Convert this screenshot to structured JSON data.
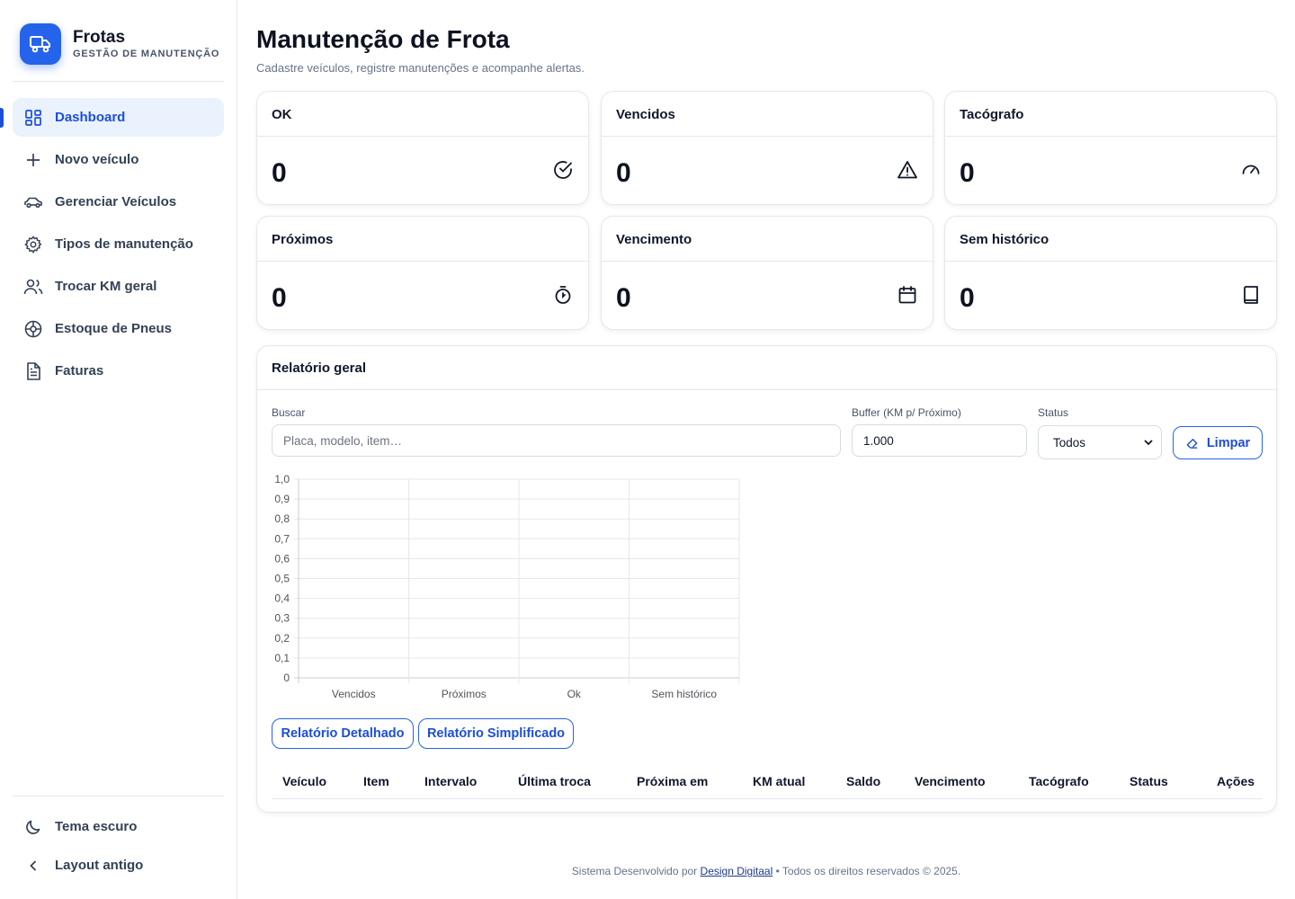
{
  "brand": {
    "title": "Frotas",
    "subtitle": "GESTÃO DE MANUTENÇÃO"
  },
  "sidebar": {
    "items": [
      {
        "label": "Dashboard",
        "icon": "dashboard-grid-icon",
        "active": true
      },
      {
        "label": "Novo veículo",
        "icon": "plus-icon"
      },
      {
        "label": "Gerenciar Veículos",
        "icon": "car-icon"
      },
      {
        "label": "Tipos de manutenção",
        "icon": "gear-icon"
      },
      {
        "label": "Trocar KM geral",
        "icon": "users-icon"
      },
      {
        "label": "Estoque de Pneus",
        "icon": "tire-icon"
      },
      {
        "label": "Faturas",
        "icon": "document-icon"
      }
    ],
    "bottom": [
      {
        "label": "Tema escuro",
        "icon": "moon-icon"
      },
      {
        "label": "Layout antigo",
        "icon": "chevron-left-icon"
      }
    ]
  },
  "header": {
    "title": "Manutenção de Frota",
    "subtitle": "Cadastre veículos, registre manutenções e acompanhe alertas."
  },
  "stats": [
    {
      "label": "OK",
      "value": "0",
      "icon": "check-circle-icon"
    },
    {
      "label": "Vencidos",
      "value": "0",
      "icon": "warning-triangle-icon"
    },
    {
      "label": "Tacógrafo",
      "value": "0",
      "icon": "gauge-icon"
    },
    {
      "label": "Próximos",
      "value": "0",
      "icon": "stopwatch-icon"
    },
    {
      "label": "Vencimento",
      "value": "0",
      "icon": "calendar-icon"
    },
    {
      "label": "Sem histórico",
      "value": "0",
      "icon": "book-icon"
    }
  ],
  "report": {
    "title": "Relatório geral",
    "search": {
      "label": "Buscar",
      "placeholder": "Placa, modelo, item…"
    },
    "buffer": {
      "label": "Buffer (KM p/ Próximo)",
      "value": "1.000"
    },
    "status": {
      "label": "Status",
      "selected": "Todos"
    },
    "clear_label": "Limpar",
    "detailed_label": "Relatório Detalhado",
    "simplified_label": "Relatório Simplificado",
    "columns": [
      "Veículo",
      "Item",
      "Intervalo",
      "Última troca",
      "Próxima em",
      "KM atual",
      "Saldo",
      "Vencimento",
      "Tacógrafo",
      "Status",
      "Ações"
    ]
  },
  "chart_data": {
    "type": "bar",
    "categories": [
      "Vencidos",
      "Próximos",
      "Ok",
      "Sem histórico"
    ],
    "values": [
      0,
      0,
      0,
      0
    ],
    "ylim": [
      0,
      1
    ],
    "yticks": [
      "0",
      "0,1",
      "0,2",
      "0,3",
      "0,4",
      "0,5",
      "0,6",
      "0,7",
      "0,8",
      "0,9",
      "1,0"
    ],
    "grid": true,
    "title": "",
    "xlabel": "",
    "ylabel": ""
  },
  "footer": {
    "prefix": "Sistema Desenvolvido por",
    "link": "Design Digitaal",
    "suffix": "• Todos os direitos reservados © 2025."
  },
  "colors": {
    "accent": "#2563eb",
    "active_bg": "#eaf2fe",
    "text": "#0f172a",
    "muted": "#64748b"
  }
}
